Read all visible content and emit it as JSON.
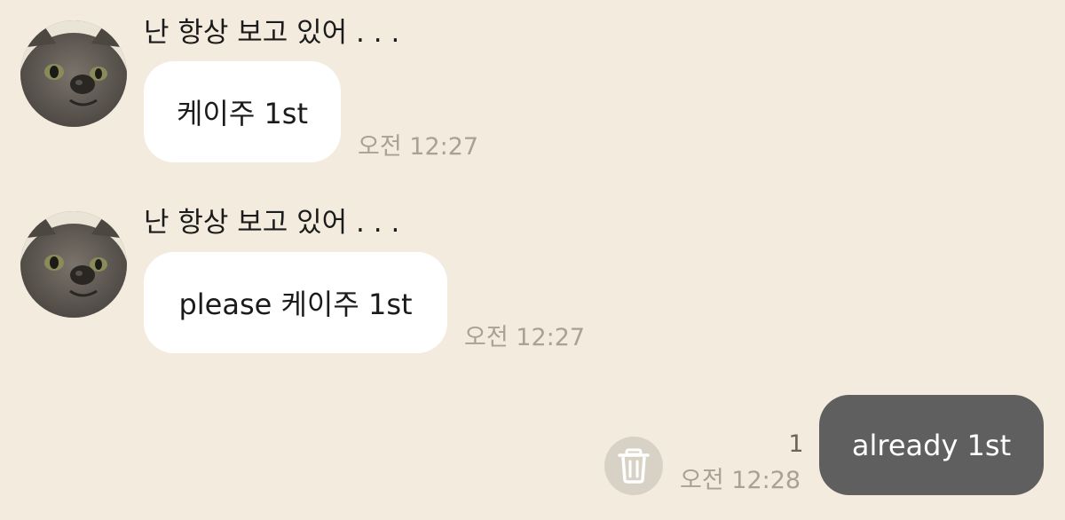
{
  "messages": [
    {
      "direction": "incoming",
      "avatar": "cat-avatar",
      "sender": "난 항상 보고 있어 . . .",
      "text": "케이주 1st",
      "time": "오전 12:27"
    },
    {
      "direction": "incoming",
      "avatar": "cat-avatar",
      "sender": "난 항상 보고 있어 . . .",
      "text": "please 케이주 1st",
      "time": "오전 12:27"
    },
    {
      "direction": "outgoing",
      "text": "already 1st",
      "unread_count": "1",
      "time": "오전 12:28",
      "action_icon": "trash-icon"
    }
  ],
  "colors": {
    "background": "#f3ebdd",
    "incoming_bubble": "#ffffff",
    "outgoing_bubble": "#5f5f5f",
    "timestamp": "#a9a294"
  }
}
